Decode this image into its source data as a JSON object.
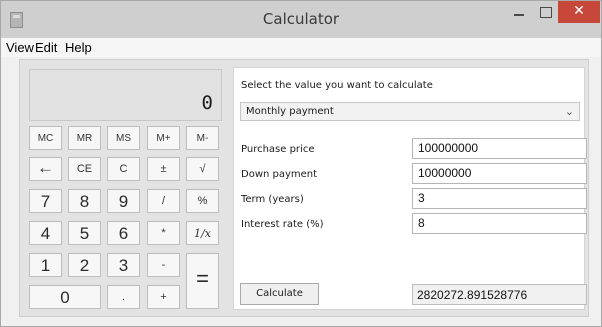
{
  "window": {
    "title": "Calculator",
    "close_glyph": "✕"
  },
  "menu": {
    "items": [
      "View",
      "Edit",
      "Help"
    ]
  },
  "display": {
    "value": "0"
  },
  "keys": {
    "memory": [
      "MC",
      "MR",
      "MS",
      "M+",
      "M-"
    ],
    "row2": [
      "←",
      "CE",
      "C",
      "±",
      "√"
    ],
    "row3": [
      "7",
      "8",
      "9",
      "/",
      "%"
    ],
    "row4": [
      "4",
      "5",
      "6",
      "*",
      "1/x"
    ],
    "row5": [
      "1",
      "2",
      "3",
      "-"
    ],
    "row6": [
      "0",
      ".",
      "+"
    ],
    "equals": "="
  },
  "panel": {
    "prompt": "Select the value you want to calculate",
    "mode": "Monthly payment",
    "fields": [
      {
        "label": "Purchase price",
        "value": "100000000"
      },
      {
        "label": "Down payment",
        "value": "10000000"
      },
      {
        "label": "Term (years)",
        "value": "3"
      },
      {
        "label": "Interest rate (%)",
        "value": "8"
      }
    ],
    "calculate_label": "Calculate",
    "result": "2820272.891528776"
  },
  "icons": {
    "app": "calculator-icon",
    "dropdown": "chevron-down-icon",
    "backspace": "arrow-left-icon"
  }
}
